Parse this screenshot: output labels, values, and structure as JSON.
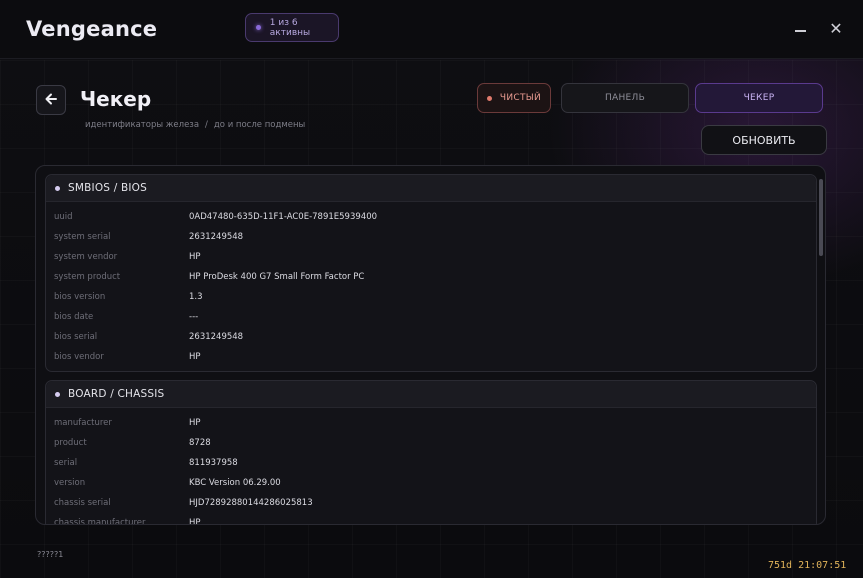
{
  "window": {
    "title": "Vengeance",
    "active_badge": "1 из 6 активны",
    "minimize_icon": "minimize-icon",
    "close_icon": "close-icon",
    "close_glyph": "✕"
  },
  "header": {
    "back_icon": "arrow-left-icon",
    "back_glyph": "🡐",
    "title": "Чекер",
    "breadcrumb": [
      "идентификаторы железа",
      "/",
      "до и после подмены"
    ]
  },
  "nav": {
    "clean_label": "ЧИСТЫЙ",
    "panel_label": "ПАНЕЛЬ",
    "checker_label": "ЧЕКЕР",
    "refresh_label": "ОБНОВИТЬ"
  },
  "sections": [
    {
      "title": "SMBIOS / BIOS",
      "rows": [
        {
          "key": "uuid",
          "value": "0AD47480-635D-11F1-AC0E-7891E5939400"
        },
        {
          "key": "system serial",
          "value": "2631249548"
        },
        {
          "key": "system vendor",
          "value": "HP"
        },
        {
          "key": "system product",
          "value": "HP ProDesk 400 G7 Small Form Factor PC"
        },
        {
          "key": "bios version",
          "value": "1.3"
        },
        {
          "key": "bios date",
          "value": "---"
        },
        {
          "key": "bios serial",
          "value": "2631249548"
        },
        {
          "key": "bios vendor",
          "value": "HP"
        }
      ]
    },
    {
      "title": "BOARD / CHASSIS",
      "rows": [
        {
          "key": "manufacturer",
          "value": "HP"
        },
        {
          "key": "product",
          "value": "8728"
        },
        {
          "key": "serial",
          "value": "811937958"
        },
        {
          "key": "version",
          "value": "KBC Version 06.29.00"
        },
        {
          "key": "chassis serial",
          "value": "HJD72892880144286025813"
        },
        {
          "key": "chassis manufacturer",
          "value": "HP"
        }
      ]
    }
  ],
  "footer": {
    "left": "?????1",
    "right": "751d 21:07:51"
  },
  "colors": {
    "accent_purple": "#8a6ad8",
    "clean_red": "#e07a6c",
    "timer_gold": "#e0b35a"
  }
}
